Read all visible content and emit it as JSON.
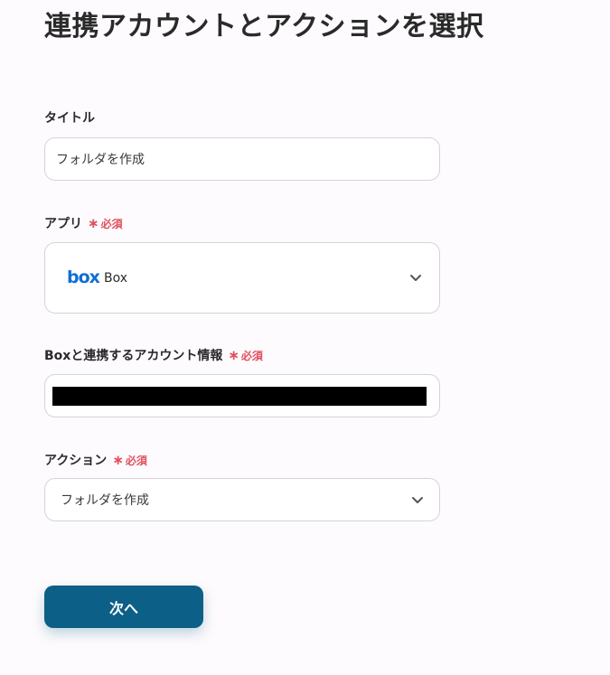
{
  "page": {
    "title": "連携アカウントとアクションを選択"
  },
  "required_label": "必須",
  "fields": {
    "title": {
      "label": "タイトル",
      "value": "フォルダを作成"
    },
    "app": {
      "label": "アプリ",
      "logo_text": "box",
      "value": "Box",
      "logo_color": "#0f6fd6"
    },
    "account": {
      "label": "Boxと連携するアカウント情報"
    },
    "action": {
      "label": "アクション",
      "value": "フォルダを作成"
    }
  },
  "buttons": {
    "next_label": "次へ"
  },
  "colors": {
    "primary": "#0c5f86",
    "required": "#e0505d"
  }
}
